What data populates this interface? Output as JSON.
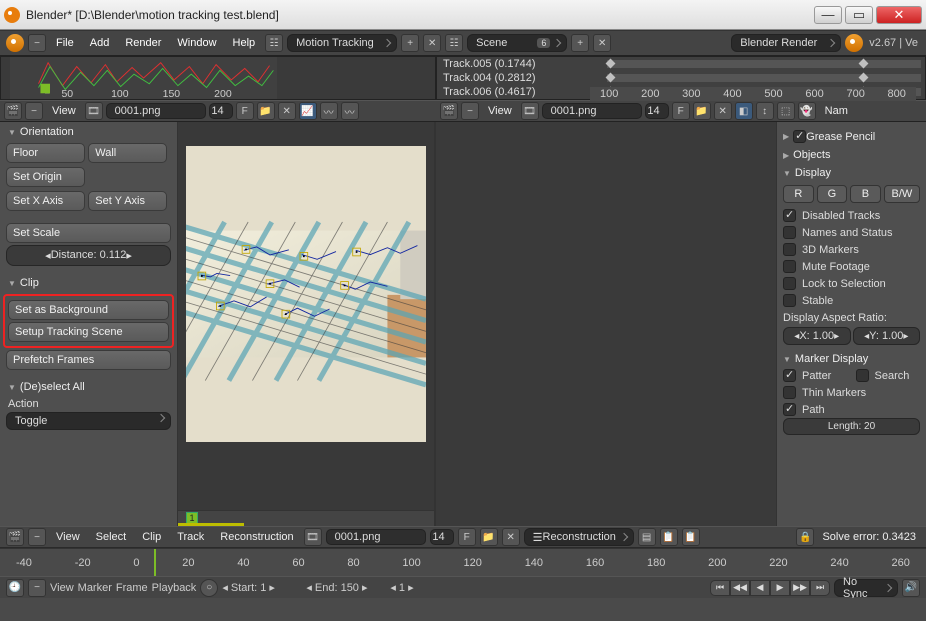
{
  "window": {
    "title": "Blender* [D:\\Blender\\motion tracking test.blend]",
    "min": "—",
    "max": "▭",
    "close": "✕"
  },
  "header": {
    "file": "File",
    "add": "Add",
    "render": "Render",
    "window": "Window",
    "help": "Help",
    "screen": "Motion Tracking",
    "scene": "Scene",
    "scene_users": "6",
    "engine": "Blender Render",
    "version": "v2.67 | Ve"
  },
  "graph": {
    "ticks": [
      "50",
      "100",
      "150",
      "200"
    ],
    "1": "1"
  },
  "dope": {
    "tracks": [
      {
        "name": "Track.005 (0.1744)"
      },
      {
        "name": "Track.004 (0.2812)"
      },
      {
        "name": "Track.006 (0.4617)"
      }
    ],
    "playhead": "1",
    "ticks": [
      "100",
      "200",
      "300",
      "400",
      "500",
      "600",
      "700",
      "800"
    ]
  },
  "left_hdr": {
    "view": "View",
    "file": "0001.png",
    "frame": "14",
    "F": "F"
  },
  "right_hdr": {
    "view": "View",
    "file": "0001.png",
    "frame": "14",
    "F": "F",
    "nam": "Nam"
  },
  "orientation": {
    "title": "Orientation",
    "floor": "Floor",
    "wall": "Wall",
    "set_origin": "Set Origin",
    "setx": "Set X Axis",
    "sety": "Set Y Axis",
    "set_scale": "Set Scale",
    "distance": "Distance: 0.112"
  },
  "clip": {
    "title": "Clip",
    "set_bg": "Set as Background",
    "setup": "Setup Tracking Scene",
    "prefetch": "Prefetch Frames"
  },
  "deselect": {
    "title": "(De)select All",
    "action": "Action",
    "toggle": "Toggle"
  },
  "right": {
    "grease": "Grease Pencil",
    "objects": "Objects",
    "display": "Display",
    "r": "R",
    "g": "G",
    "b": "B",
    "bw": "B/W",
    "disabled": "Disabled Tracks",
    "names": "Names and Status",
    "markers3d": "3D Markers",
    "mute": "Mute Footage",
    "lock": "Lock to Selection",
    "stable": "Stable",
    "aspect": "Display Aspect Ratio:",
    "x": "X: 1.00",
    "y": "Y: 1.00",
    "markerdisp": "Marker Display",
    "pattern": "Patter",
    "search": "Search",
    "thin": "Thin Markers",
    "path": "Path",
    "length": "Length: 20"
  },
  "bottombar": {
    "view": "View",
    "select": "Select",
    "clip": "Clip",
    "track": "Track",
    "recon": "Reconstruction",
    "file": "0001.png",
    "frame": "14",
    "F": "F",
    "mode": "Reconstruction",
    "solve": "Solve error: 0.3423"
  },
  "timeline": {
    "ticks": [
      "-40",
      "-20",
      "0",
      "20",
      "40",
      "60",
      "80",
      "100",
      "120",
      "140",
      "160",
      "180",
      "200",
      "220",
      "240",
      "260"
    ]
  },
  "play": {
    "view": "View",
    "marker": "Marker",
    "frame": "Frame",
    "playback": "Playback",
    "start": "Start: 1",
    "end": "End: 150",
    "cur": "1",
    "sync": "No Sync"
  }
}
